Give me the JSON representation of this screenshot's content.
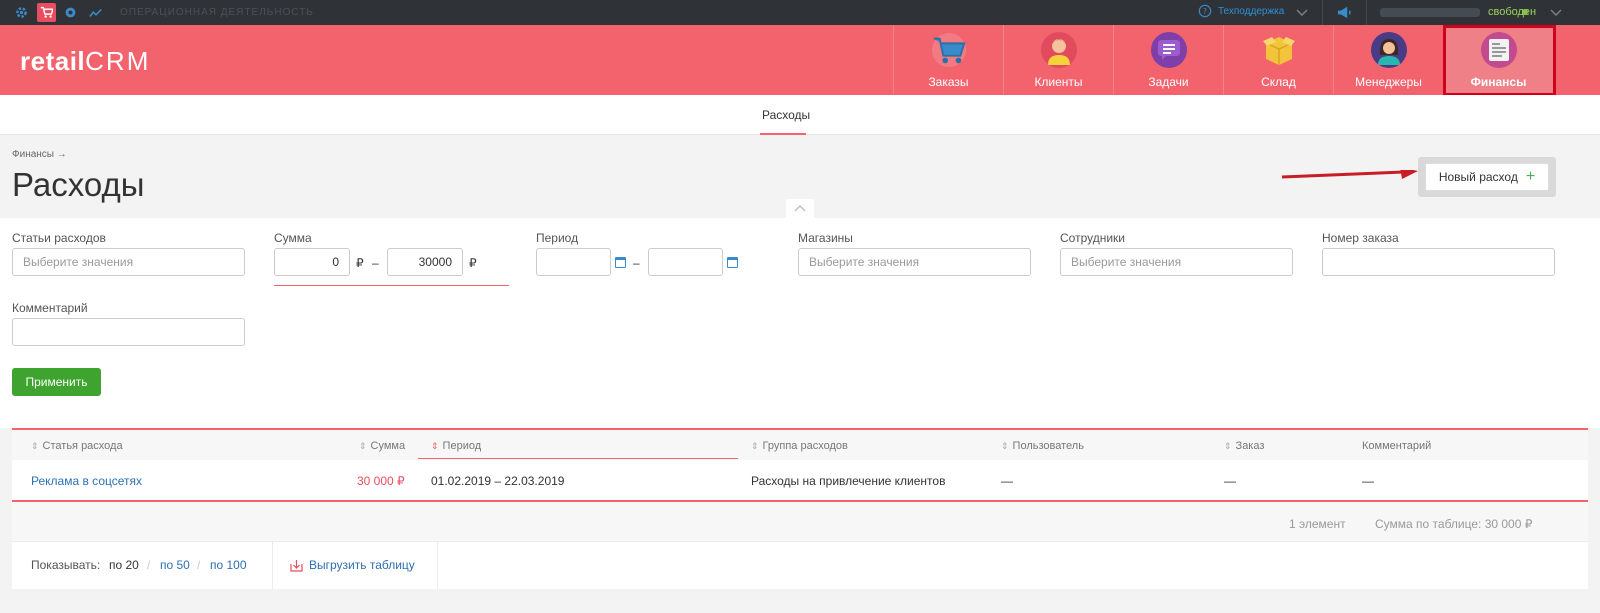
{
  "topbar": {
    "section_label": "ОПЕРАЦИОННАЯ ДЕЯТЕЛЬНОСТЬ",
    "support_label": "Техподдержка",
    "status_label": "свободен"
  },
  "header": {
    "logo_text": "retail",
    "logo_crm": "CRM",
    "nav": [
      {
        "label": "Заказы"
      },
      {
        "label": "Клиенты"
      },
      {
        "label": "Задачи"
      },
      {
        "label": "Склад"
      },
      {
        "label": "Менеджеры"
      },
      {
        "label": "Финансы"
      }
    ]
  },
  "subnav": {
    "tab": "Расходы"
  },
  "page": {
    "breadcrumb": "Финансы →",
    "title": "Расходы",
    "new_button": "Новый расход",
    "new_button_plus": "+"
  },
  "filters": {
    "expense_items": {
      "label": "Статьи расходов",
      "placeholder": "Выберите значения"
    },
    "sum": {
      "label": "Сумма",
      "from": "0",
      "to": "30000",
      "currency": "₽",
      "dash": "–"
    },
    "period": {
      "label": "Период",
      "dash": "–"
    },
    "shops": {
      "label": "Магазины",
      "placeholder": "Выберите значения"
    },
    "employees": {
      "label": "Сотрудники",
      "placeholder": "Выберите значения"
    },
    "order_number": {
      "label": "Номер заказа"
    },
    "comment": {
      "label": "Комментарий"
    },
    "apply_button": "Применить"
  },
  "table": {
    "headers": [
      "Статья расхода",
      "Сумма",
      "Период",
      "Группа расходов",
      "Пользователь",
      "Заказ",
      "Комментарий"
    ],
    "rows": [
      [
        "Реклама в соцсетях",
        "30 000 ₽",
        "01.02.2019 – 22.03.2019",
        "Расходы на привлечение клиентов",
        "—",
        "—",
        "—"
      ]
    ],
    "count": "1 элемент",
    "total": "Сумма по таблице: 30 000 ₽"
  },
  "footer": {
    "show_label": "Показывать:",
    "per_page": [
      "по 20",
      "по 50",
      "по 100"
    ],
    "sep": "/",
    "export_label": "Выгрузить таблицу"
  }
}
